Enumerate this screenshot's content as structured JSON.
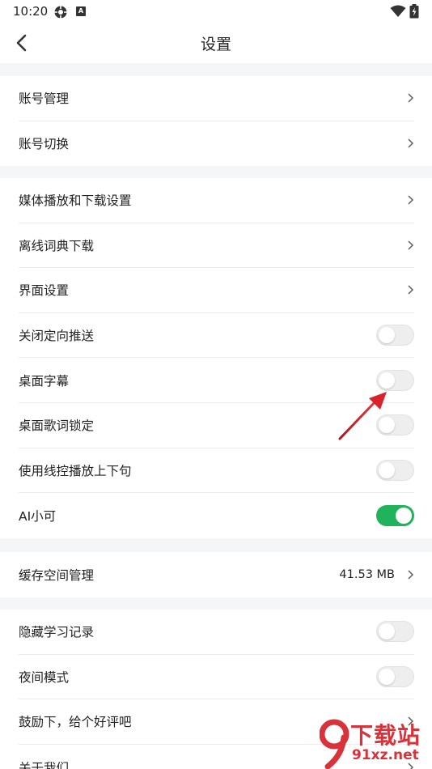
{
  "status_bar": {
    "time": "10:20",
    "icons": [
      "settings-icon",
      "a-notification-icon",
      "wifi-icon",
      "battery-icon"
    ]
  },
  "header": {
    "title": "设置",
    "back_icon": "chevron-left-icon"
  },
  "groups": [
    {
      "items": [
        {
          "label": "账号管理",
          "control": "chevron"
        },
        {
          "label": "账号切换",
          "control": "chevron"
        }
      ]
    },
    {
      "items": [
        {
          "label": "媒体播放和下载设置",
          "control": "chevron"
        },
        {
          "label": "离线词典下载",
          "control": "chevron"
        },
        {
          "label": "界面设置",
          "control": "chevron"
        },
        {
          "label": "关闭定向推送",
          "control": "toggle",
          "on": false
        },
        {
          "label": "桌面字幕",
          "control": "toggle",
          "on": false
        },
        {
          "label": "桌面歌词锁定",
          "control": "toggle",
          "on": false
        },
        {
          "label": "使用线控播放上下句",
          "control": "toggle",
          "on": false
        },
        {
          "label": "AI小可",
          "control": "toggle",
          "on": true
        }
      ]
    },
    {
      "items": [
        {
          "label": "缓存空间管理",
          "value": "41.53 MB",
          "control": "chevron"
        }
      ]
    },
    {
      "items": [
        {
          "label": "隐藏学习记录",
          "control": "toggle",
          "on": false
        },
        {
          "label": "夜间模式",
          "control": "toggle",
          "on": false
        },
        {
          "label": "鼓励下，给个好评吧",
          "control": "chevron"
        },
        {
          "label": "关于我们",
          "control": "chevron"
        }
      ]
    }
  ],
  "colors": {
    "toggle_on": "#21b35c",
    "toggle_off": "#eeeeee",
    "annotation_arrow": "#d8232a"
  },
  "watermark": {
    "brand": "下载站",
    "url": "91xz.net"
  }
}
